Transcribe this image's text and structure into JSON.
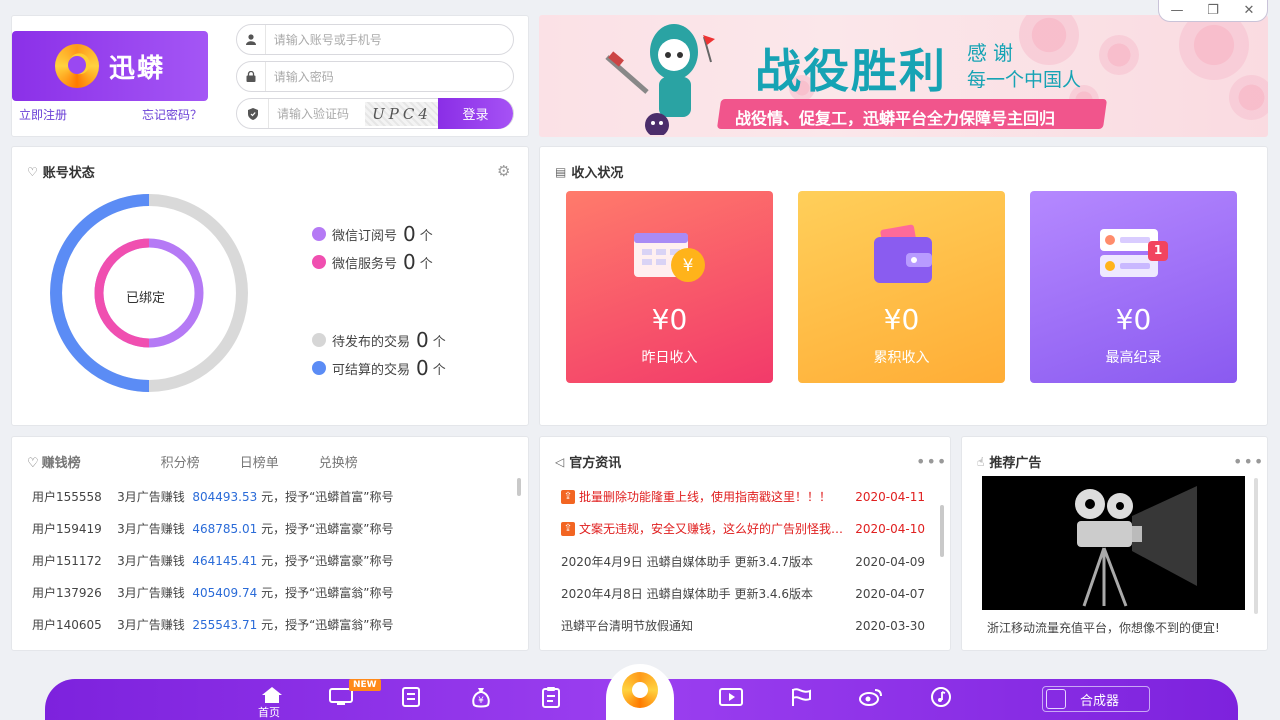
{
  "window": {
    "minimize": "—",
    "restore": "❐",
    "close": "✕"
  },
  "login": {
    "brand": "迅蟒",
    "register_label": "立即注册",
    "forgot_label": "忘记密码？",
    "account_placeholder": "请输入账号或手机号",
    "password_placeholder": "请输入密码",
    "captcha_placeholder": "请输入验证码",
    "captcha_text": "UPC4",
    "login_label": "登录"
  },
  "banner": {
    "title": "战役胜利",
    "thanks": "感谢",
    "subtitle": "每一个中国人",
    "slogan": "战役情、促复工，迅蟒平台全力保障号主回归"
  },
  "account_status": {
    "title": "账号状态",
    "center_label": "已绑定",
    "legend": [
      {
        "label": "微信订阅号",
        "count": "0",
        "unit": "个",
        "color": "#b57af5"
      },
      {
        "label": "微信服务号",
        "count": "0",
        "unit": "个",
        "color": "#f04fb0"
      },
      {
        "label": "待发布的交易",
        "count": "0",
        "unit": "个",
        "color": "#d6d6d6"
      },
      {
        "label": "可结算的交易",
        "count": "0",
        "unit": "个",
        "color": "#5b8cf5"
      }
    ]
  },
  "income": {
    "title": "收入状况",
    "cards": [
      {
        "amount": "¥0",
        "label": "昨日收入"
      },
      {
        "amount": "¥0",
        "label": "累积收入"
      },
      {
        "amount": "¥0",
        "label": "最高纪录"
      }
    ],
    "badge": "1"
  },
  "ranking": {
    "tabs": [
      "赚钱榜",
      "积分榜",
      "日榜单",
      "兑换榜"
    ],
    "rows": [
      {
        "user": "用户155558",
        "month": "3月广告赚钱",
        "amount": "804493.53",
        "suffix": "元，授予“迅蟒首富”称号"
      },
      {
        "user": "用户159419",
        "month": "3月广告赚钱",
        "amount": "468785.01",
        "suffix": "元，授予“迅蟒富豪”称号"
      },
      {
        "user": "用户151172",
        "month": "3月广告赚钱",
        "amount": "464145.41",
        "suffix": "元，授予“迅蟒富豪”称号"
      },
      {
        "user": "用户137926",
        "month": "3月广告赚钱",
        "amount": "405409.74",
        "suffix": "元，授予“迅蟒富翁”称号"
      },
      {
        "user": "用户140605",
        "month": "3月广告赚钱",
        "amount": "255543.71",
        "suffix": "元，授予“迅蟒富翁”称号"
      }
    ]
  },
  "news": {
    "title": "官方资讯",
    "more": "•••",
    "rows": [
      {
        "title": "批量删除功能隆重上线，使用指南戳这里！！！",
        "date": "2020-04-11"
      },
      {
        "title": "文案无违规，安全又赚钱，这么好的广告别怪我没...",
        "date": "2020-04-10"
      },
      {
        "title": "2020年4月9日 迅蟒自媒体助手 更新3.4.7版本",
        "date": "2020-04-09"
      },
      {
        "title": "2020年4月8日 迅蟒自媒体助手 更新3.4.6版本",
        "date": "2020-04-07"
      },
      {
        "title": "迅蟒平台清明节放假通知",
        "date": "2020-03-30"
      }
    ]
  },
  "ads": {
    "title": "推荐广告",
    "more": "•••",
    "caption": "浙江移动流量充值平台，你想像不到的便宜!"
  },
  "bottom": {
    "home_label": "首页",
    "new_badge": "NEW",
    "synth_label": "合成器"
  }
}
